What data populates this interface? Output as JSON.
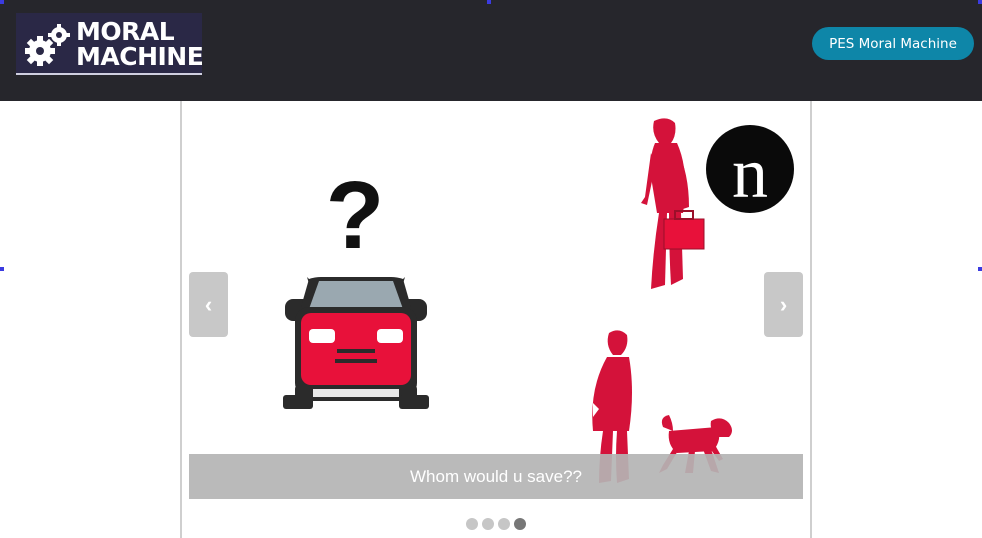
{
  "header": {
    "logo_line1": "MORAL",
    "logo_line2": "MACHINE",
    "pes_button_label": "PES Moral Machine"
  },
  "carousel": {
    "question_mark": "?",
    "news_badge_letter": "n",
    "prev_label": "‹",
    "next_label": "›",
    "caption": "Whom would u save??",
    "slide_count": 4,
    "active_index": 3
  },
  "colors": {
    "topbar": "#26262c",
    "accent_button": "#0e86a8",
    "figure_red": "#d4123a",
    "car_red": "#e8113a"
  }
}
